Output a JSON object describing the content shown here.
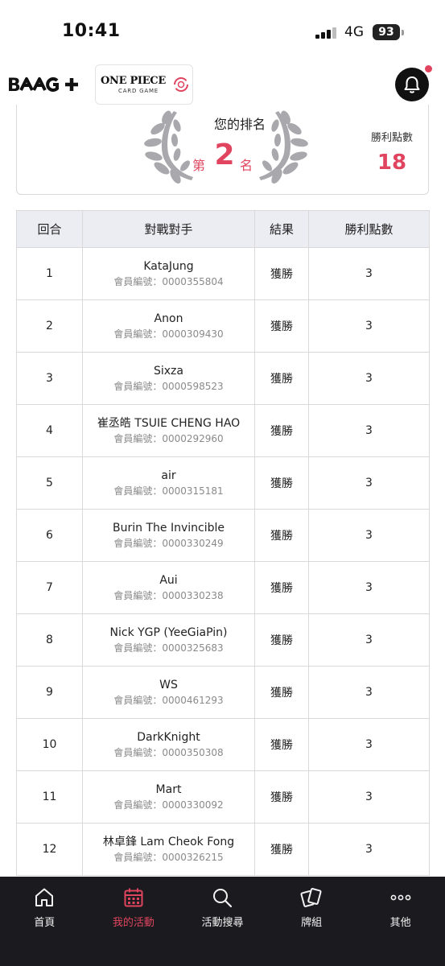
{
  "status_bar": {
    "time": "10:41",
    "network": "4G",
    "battery": "93"
  },
  "header": {
    "brand_name": "BAAG+",
    "partner_logo": {
      "title": "ONE PIECE",
      "subtitle": "CARD GAME"
    }
  },
  "rank_card": {
    "label": "您的排名",
    "rank_prefix": "第",
    "rank_value": "2",
    "rank_suffix": "名",
    "wins_label": "勝利點數",
    "wins_value": "18"
  },
  "table": {
    "headers": [
      "回合",
      "對戰對手",
      "結果",
      "勝利點數"
    ],
    "member_prefix": "會員編號：",
    "rows": [
      {
        "round": "1",
        "opponent": "KataJung",
        "member_id": "會員編號：0000355804",
        "result": "獲勝",
        "points": "3"
      },
      {
        "round": "2",
        "opponent": "Anon",
        "member_id": "會員編號：0000309430",
        "result": "獲勝",
        "points": "3"
      },
      {
        "round": "3",
        "opponent": "Sixza",
        "member_id": "會員編號：0000598523",
        "result": "獲勝",
        "points": "3"
      },
      {
        "round": "4",
        "opponent": "崔丞皓 TSUIE CHENG HAO",
        "member_id": "會員編號：0000292960",
        "result": "獲勝",
        "points": "3"
      },
      {
        "round": "5",
        "opponent": "air",
        "member_id": "會員編號：0000315181",
        "result": "獲勝",
        "points": "3"
      },
      {
        "round": "6",
        "opponent": "Burin The Invincible",
        "member_id": "會員編號：0000330249",
        "result": "獲勝",
        "points": "3"
      },
      {
        "round": "7",
        "opponent": "Aui",
        "member_id": "會員編號：0000330238",
        "result": "獲勝",
        "points": "3"
      },
      {
        "round": "8",
        "opponent": "Nick YGP (YeeGiaPin)",
        "member_id": "會員編號：0000325683",
        "result": "獲勝",
        "points": "3"
      },
      {
        "round": "9",
        "opponent": "WS",
        "member_id": "會員編號：0000461293",
        "result": "獲勝",
        "points": "3"
      },
      {
        "round": "10",
        "opponent": "DarkKnight",
        "member_id": "會員編號：0000350308",
        "result": "獲勝",
        "points": "3"
      },
      {
        "round": "11",
        "opponent": "Mart",
        "member_id": "會員編號：0000330092",
        "result": "獲勝",
        "points": "3"
      },
      {
        "round": "12",
        "opponent": "林卓鋒 Lam Cheok Fong",
        "member_id": "會員編號：0000326215",
        "result": "獲勝",
        "points": "3"
      }
    ]
  },
  "bottom_nav": {
    "items": [
      {
        "label": "首頁",
        "icon": "home-icon",
        "active": false
      },
      {
        "label": "我的活動",
        "icon": "calendar-icon",
        "active": true
      },
      {
        "label": "活動搜尋",
        "icon": "search-icon",
        "active": false
      },
      {
        "label": "牌組",
        "icon": "cards-icon",
        "active": false
      },
      {
        "label": "其他",
        "icon": "more-icon",
        "active": false
      }
    ]
  },
  "colors": {
    "accent": "#e0445e",
    "nav_bg": "#1b1b1f",
    "table_header_bg": "#ececf3"
  }
}
